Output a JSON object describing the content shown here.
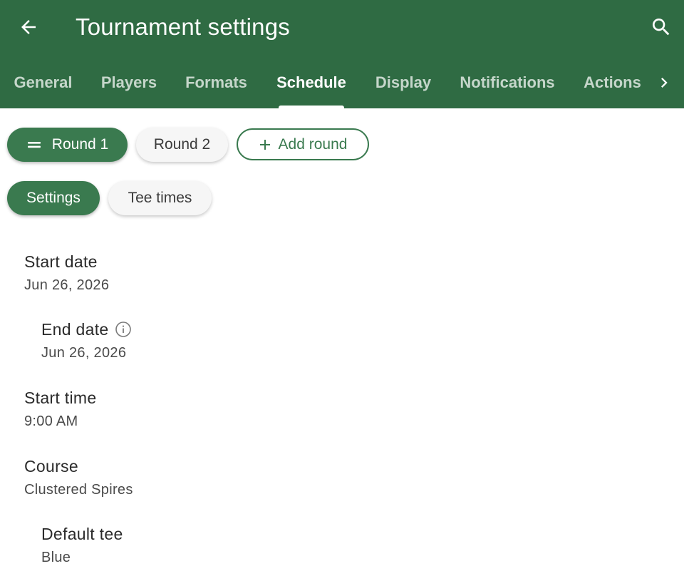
{
  "app_bar": {
    "title": "Tournament settings",
    "back_icon": "arrow-left-icon",
    "search_icon": "search-icon",
    "color": "#2f6b43"
  },
  "tabs": [
    {
      "label": "General",
      "active": false
    },
    {
      "label": "Players",
      "active": false
    },
    {
      "label": "Formats",
      "active": false
    },
    {
      "label": "Schedule",
      "active": true
    },
    {
      "label": "Display",
      "active": false
    },
    {
      "label": "Notifications",
      "active": false
    },
    {
      "label": "Actions",
      "active": false
    }
  ],
  "rounds": {
    "items": [
      {
        "label": "Round 1",
        "selected": true,
        "icon": "drag-handle-icon"
      },
      {
        "label": "Round 2",
        "selected": false
      }
    ],
    "add_label": "Add round",
    "add_icon": "plus-icon"
  },
  "sections": {
    "items": [
      {
        "label": "Settings",
        "selected": true
      },
      {
        "label": "Tee times",
        "selected": false
      }
    ]
  },
  "fields": {
    "start_date": {
      "label": "Start date",
      "value": "Jun 26, 2026"
    },
    "end_date": {
      "label": "End date",
      "value": "Jun 26, 2026",
      "icon": "info-icon"
    },
    "start_time": {
      "label": "Start time",
      "value": "9:00 AM"
    },
    "course": {
      "label": "Course",
      "value": "Clustered Spires"
    },
    "default_tee": {
      "label": "Default tee",
      "value": "Blue"
    }
  },
  "colors": {
    "accent": "#3a7a4f",
    "header": "#2f6b43"
  }
}
